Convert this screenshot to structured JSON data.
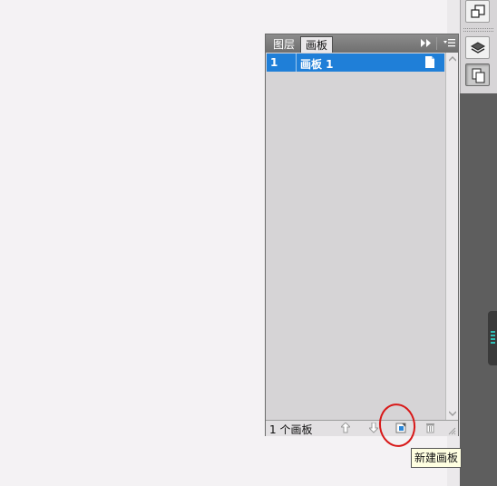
{
  "panel": {
    "tabs": [
      {
        "label": "图层",
        "active": false
      },
      {
        "label": "画板",
        "active": true
      }
    ],
    "rows": [
      {
        "number": "1",
        "name": "画板 1",
        "selected": true
      }
    ],
    "footer": {
      "count_label": "1 个画板"
    }
  },
  "tooltip": {
    "text": "新建画板"
  },
  "dock": {
    "icons": [
      "artboard-icon",
      "layers-icon",
      "artboards-panel-icon"
    ]
  },
  "colors": {
    "selection": "#1f7fd8",
    "annotation": "#d81818",
    "tooltip_bg": "#ffffe1"
  }
}
